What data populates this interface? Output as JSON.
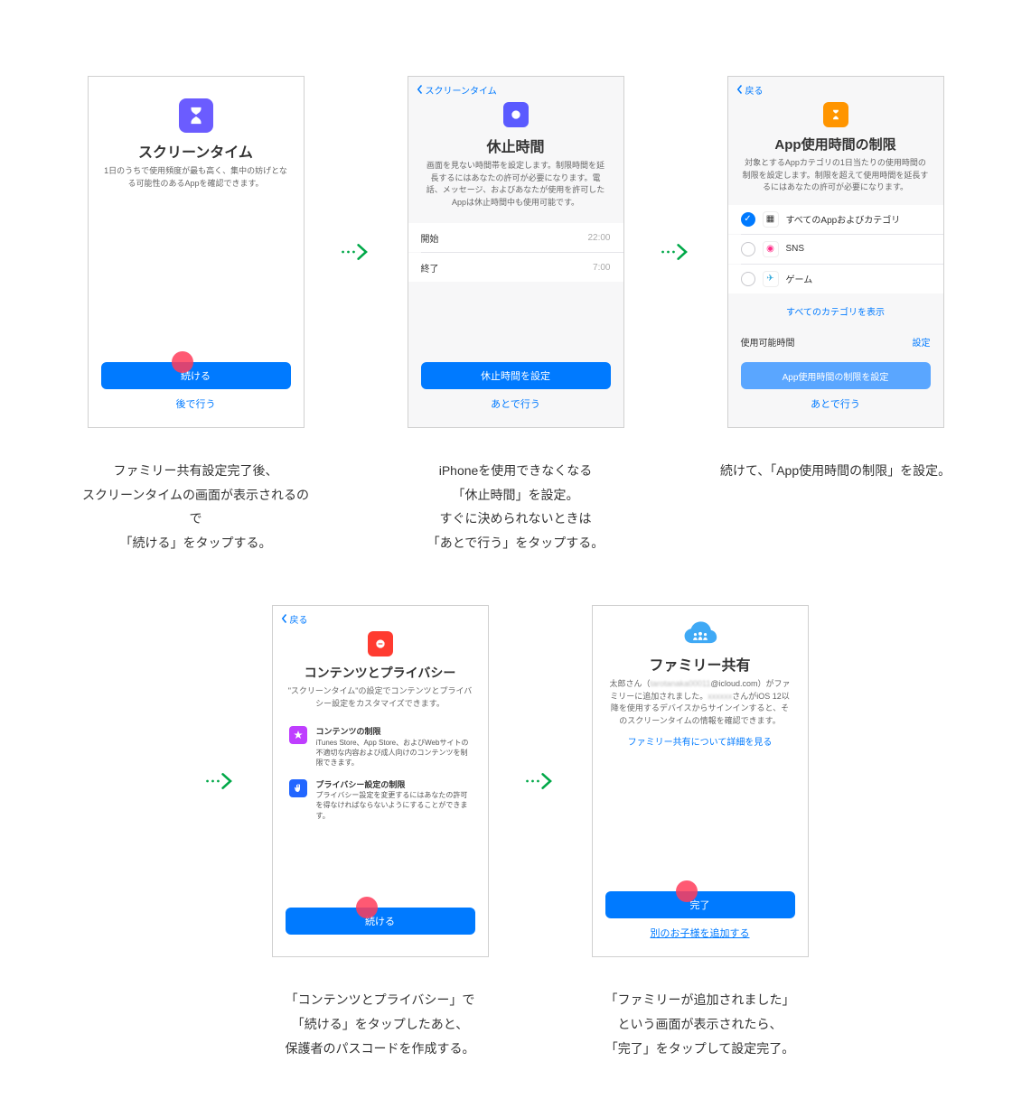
{
  "nav": {
    "back": "戻る",
    "screen_time": "スクリーンタイム"
  },
  "screen1": {
    "title": "スクリーンタイム",
    "desc": "1日のうちで使用頻度が最も高く、集中の妨げとなる可能性のあるAppを確認できます。",
    "primary": "続ける",
    "link": "後で行う"
  },
  "screen2": {
    "title": "休止時間",
    "desc": "画面を見ない時間帯を設定します。制限時間を延長するにはあなたの許可が必要になります。電話、メッセージ、およびあなたが使用を許可したAppは休止時間中も使用可能です。",
    "start_label": "開始",
    "start_val": "22:00",
    "end_label": "終了",
    "end_val": "7:00",
    "primary": "休止時間を設定",
    "link": "あとで行う"
  },
  "screen3": {
    "title": "App使用時間の制限",
    "desc": "対象とするAppカテゴリの1日当たりの使用時間の制限を設定します。制限を超えて使用時間を延長するにはあなたの許可が必要になります。",
    "cats": [
      "すべてのAppおよびカテゴリ",
      "SNS",
      "ゲーム"
    ],
    "show_all": "すべてのカテゴリを表示",
    "time_label": "使用可能時間",
    "time_action": "設定",
    "primary": "App使用時間の制限を設定",
    "link": "あとで行う"
  },
  "screen4": {
    "title": "コンテンツとプライバシー",
    "desc": "\"スクリーンタイム\"の設定でコンテンツとプライバシー設定をカスタマイズできます。",
    "f1": {
      "t": "コンテンツの制限",
      "d": "iTunes Store、App Store、およびWebサイトの不適切な内容および成人向けのコンテンツを制限できます。"
    },
    "f2": {
      "t": "プライバシー設定の制限",
      "d": "プライバシー設定を変更するにはあなたの許可を得なければならないようにすることができます。"
    },
    "primary": "続ける"
  },
  "screen5": {
    "title": "ファミリー共有",
    "desc_name": "太郎さん（",
    "desc_email": "tarotanaka00011",
    "desc_domain": "@icloud.com）",
    "desc2": "がファミリーに追加されました。",
    "desc3": "さんがiOS 12以降を使用するデバイスからサインインすると、そのスクリーンタイムの情報を確認できます。",
    "learn": "ファミリー共有について詳細を見る",
    "primary": "完了",
    "link": "別のお子様を追加する"
  },
  "captions": [
    "ファミリー共有設定完了後、\nスクリーンタイムの画面が表示されるので\n「続ける」をタップする。",
    "iPhoneを使用できなくなる\n「休止時間」を設定。\nすぐに決められないときは\n「あとで行う」をタップする。",
    "続けて、「App使用時間の制限」を設定。",
    "「コンテンツとプライバシー」で\n「続ける」をタップしたあと、\n保護者のパスコードを作成する。",
    "「ファミリーが追加されました」\nという画面が表示されたら、\n「完了」をタップして設定完了。"
  ]
}
